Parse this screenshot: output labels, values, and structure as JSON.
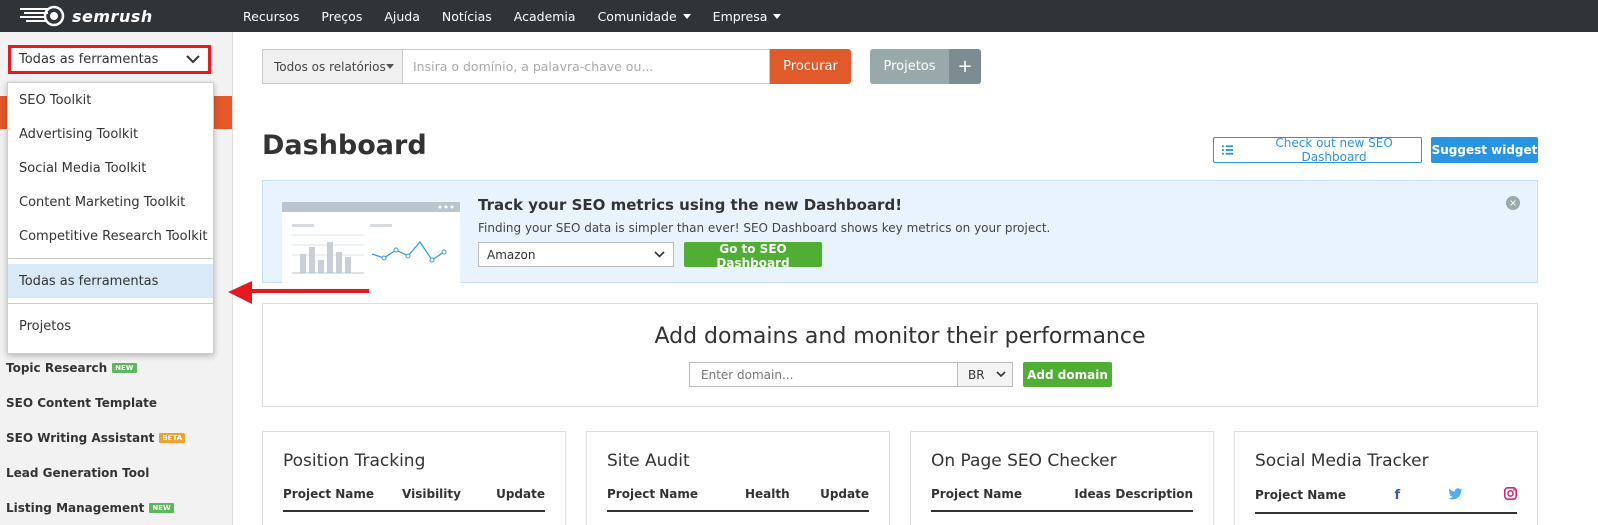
{
  "brand": {
    "name": "semrush"
  },
  "nav": {
    "items": [
      {
        "label": "Recursos",
        "caret": false
      },
      {
        "label": "Preços",
        "caret": false
      },
      {
        "label": "Ajuda",
        "caret": false
      },
      {
        "label": "Notícias",
        "caret": false
      },
      {
        "label": "Academia",
        "caret": false
      },
      {
        "label": "Comunidade",
        "caret": true
      },
      {
        "label": "Empresa",
        "caret": true
      }
    ]
  },
  "sidebar": {
    "tool_select_label": "Todas as ferramentas",
    "dropdown": {
      "items": [
        "SEO Toolkit",
        "Advertising Toolkit",
        "Social Media Toolkit",
        "Content Marketing Toolkit",
        "Competitive Research Toolkit"
      ],
      "active_item": "Todas as ferramentas",
      "projects_item": "Projetos"
    },
    "items": [
      {
        "label": "Topic Research",
        "badge": "NEW"
      },
      {
        "label": "SEO Content Template",
        "badge": ""
      },
      {
        "label": "SEO Writing Assistant",
        "badge": "BETA"
      },
      {
        "label": "Lead Generation Tool",
        "badge": ""
      },
      {
        "label": "Listing Management",
        "badge": "NEW"
      }
    ]
  },
  "search": {
    "report_select": "Todos os relatórios",
    "placeholder": "Insira o domínio, a palavra-chave ou...",
    "button": "Procurar",
    "projects_button": "Projetos",
    "plus": "+"
  },
  "dashboard": {
    "title": "Dashboard",
    "check_button": "Check out new SEO Dashboard",
    "suggest_button": "Suggest widget"
  },
  "promo": {
    "title": "Track your SEO metrics using the new Dashboard!",
    "subtitle": "Finding your SEO data is simpler than ever! SEO Dashboard shows key metrics on your project.",
    "select_value": "Amazon",
    "go_button": "Go to SEO Dashboard",
    "close": "×"
  },
  "add_domain": {
    "title": "Add domains and monitor their performance",
    "placeholder": "Enter domain...",
    "country": "BR",
    "button": "Add domain"
  },
  "widgets": [
    {
      "title": "Position Tracking",
      "columns": [
        "Project Name",
        "Visibility",
        "Update"
      ]
    },
    {
      "title": "Site Audit",
      "columns": [
        "Project Name",
        "Health",
        "Update"
      ]
    },
    {
      "title": "On Page SEO Checker",
      "columns": [
        "Project Name",
        "Ideas",
        "Description"
      ]
    },
    {
      "title": "Social Media Tracker",
      "columns": [
        "Project Name"
      ],
      "social_icons": [
        "facebook-icon",
        "twitter-icon",
        "instagram-icon"
      ]
    }
  ],
  "colors": {
    "topbar": "#2e3438",
    "accent_orange": "#e05a2b",
    "blue": "#2b94e1",
    "green": "#4fae33",
    "highlight_red": "#e8181f"
  }
}
